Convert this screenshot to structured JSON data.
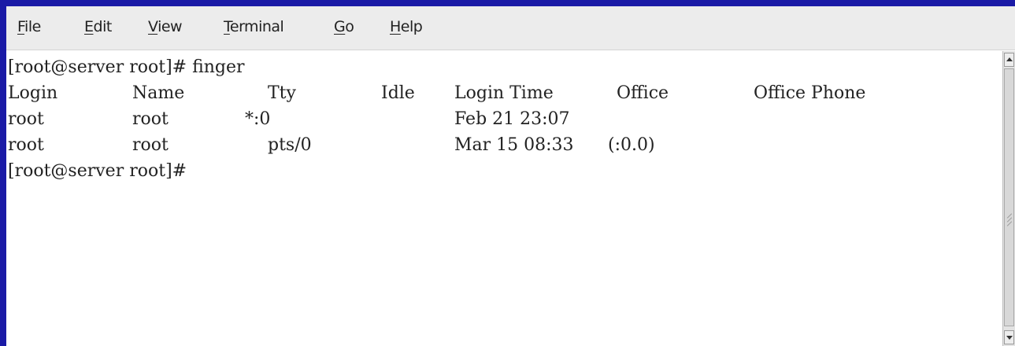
{
  "menu": {
    "items": [
      {
        "mnemonic": "F",
        "rest": "ile"
      },
      {
        "mnemonic": "E",
        "rest": "dit"
      },
      {
        "mnemonic": "V",
        "rest": "iew"
      },
      {
        "mnemonic": "T",
        "rest": "erminal"
      },
      {
        "mnemonic": "G",
        "rest": "o"
      },
      {
        "mnemonic": "H",
        "rest": "elp"
      }
    ]
  },
  "terminal": {
    "command_line": "[root@server root]# finger",
    "headers": {
      "login": "Login",
      "name": "Name",
      "tty": "Tty",
      "idle": "Idle",
      "login_time": "Login Time",
      "office": "Office",
      "office_phone": "Office Phone"
    },
    "rows": [
      {
        "login": "root",
        "name": "root",
        "tty": "*:0",
        "idle": "",
        "login_time": "Feb 21 23:07",
        "office": ""
      },
      {
        "login": "root",
        "name": "root",
        "tty": "pts/0",
        "idle": "",
        "login_time": "Mar 15 08:33",
        "office": "(:0.0)"
      }
    ],
    "prompt": "[root@server root]#"
  },
  "colors": {
    "background": "#1a1aa6",
    "terminal_bg": "#ffffff",
    "text": "#222222",
    "menubar": "#ececec"
  }
}
